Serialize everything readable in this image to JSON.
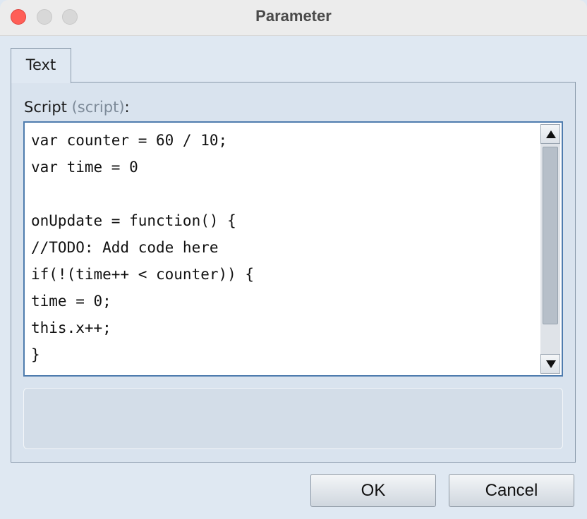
{
  "window": {
    "title": "Parameter"
  },
  "tabs": [
    {
      "label": "Text"
    }
  ],
  "field": {
    "label": "Script",
    "hint": "(script)",
    "colon": ":"
  },
  "editor": {
    "lines": [
      "var counter = 60 / 10;",
      "var time = 0",
      "",
      "onUpdate = function() {",
      "//TODO: Add code here",
      "if(!(time++ < counter)) {",
      "time = 0;",
      "this.x++;",
      "}"
    ]
  },
  "description": {
    "text": ""
  },
  "buttons": {
    "ok": "OK",
    "cancel": "Cancel"
  }
}
